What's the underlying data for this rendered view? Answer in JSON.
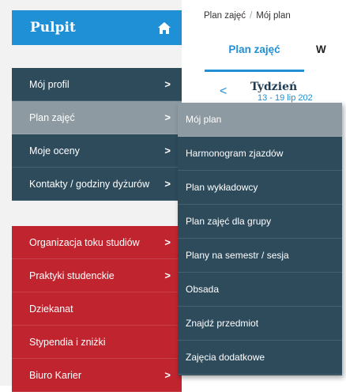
{
  "sidebar": {
    "title": "Pulpit",
    "dark_items": [
      {
        "label": "Mój profil",
        "chevron": ">"
      },
      {
        "label": "Plan zajęć",
        "chevron": ">"
      },
      {
        "label": "Moje oceny",
        "chevron": ">"
      },
      {
        "label": "Kontakty / godziny dyżurów",
        "chevron": ">"
      }
    ],
    "red_items": [
      {
        "label": "Organizacja toku studiów",
        "chevron": ">"
      },
      {
        "label": "Praktyki studenckie",
        "chevron": ">"
      },
      {
        "label": "Dziekanat"
      },
      {
        "label": "Stypendia i zniżki"
      },
      {
        "label": "Biuro Karier",
        "chevron": ">"
      }
    ]
  },
  "breadcrumb": {
    "item1": "Plan zajęć",
    "separator": "/",
    "item2": "Mój plan"
  },
  "tabs": [
    {
      "label": "Plan zajęć"
    },
    {
      "label": "W"
    }
  ],
  "week": {
    "prev": "<",
    "title": "Tydzień",
    "dates": "13 - 19 lip 202"
  },
  "submenu": {
    "items": [
      {
        "label": "Mój plan"
      },
      {
        "label": "Harmonogram zjazdów"
      },
      {
        "label": "Plan wykładowcy"
      },
      {
        "label": "Plan zajęć dla grupy"
      },
      {
        "label": "Plany na semestr / sesja"
      },
      {
        "label": "Obsada"
      },
      {
        "label": "Znajdź przedmiot"
      },
      {
        "label": "Zajęcia dodatkowe"
      }
    ]
  },
  "colors": {
    "brand_blue": "#1f8fd6",
    "nav_dark": "#2e4b5c",
    "nav_active": "#8e9aa1",
    "nav_red": "#c0252f"
  }
}
